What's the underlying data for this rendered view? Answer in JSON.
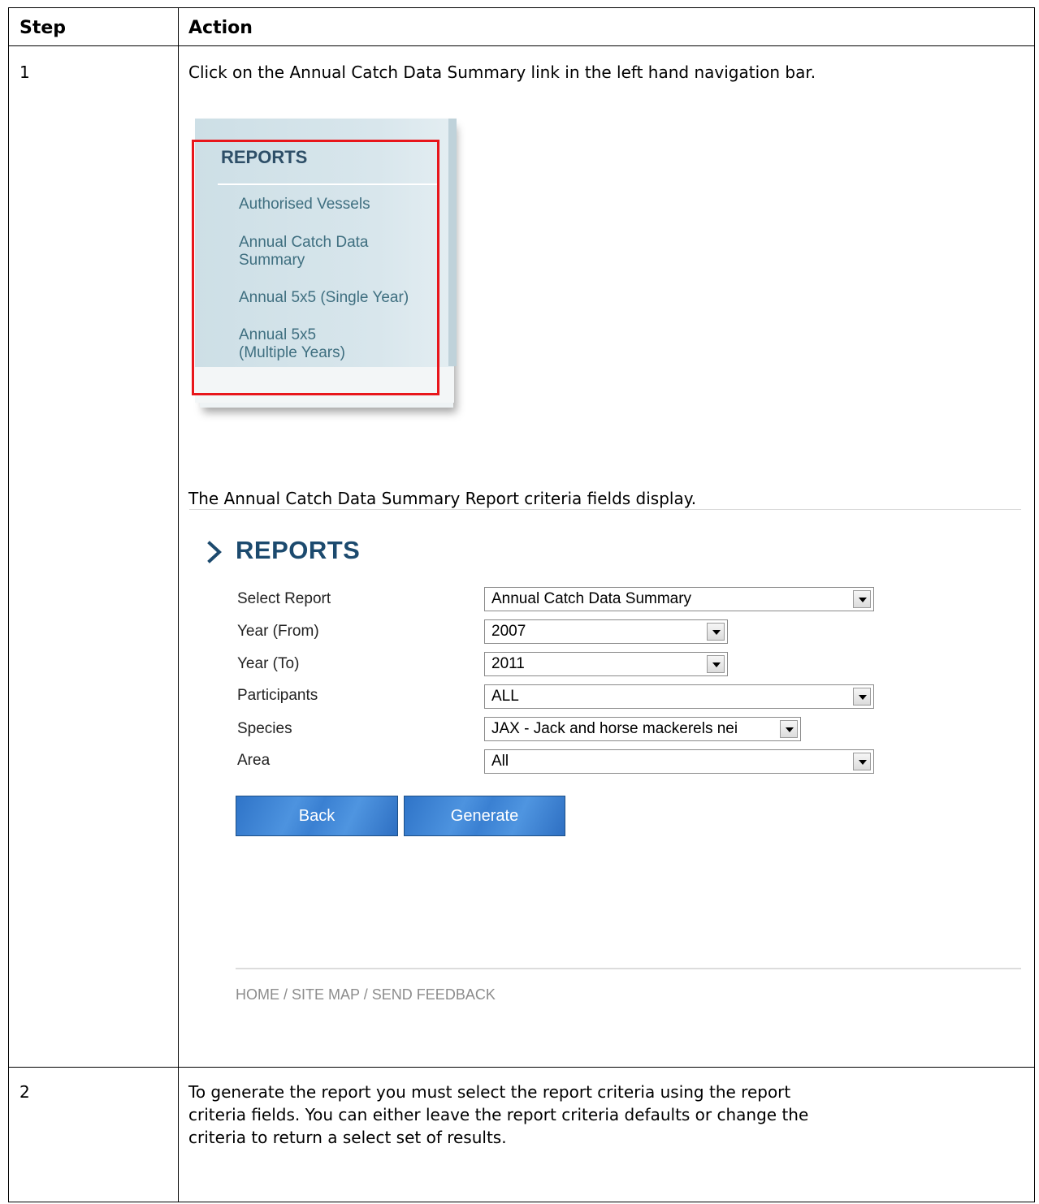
{
  "table": {
    "headers": {
      "step": "Step",
      "action": "Action"
    },
    "rows": [
      {
        "step": "1",
        "intro": "Click on the Annual Catch Data Summary link in the left hand navigation bar.",
        "display_note": "The Annual Catch Data Summary Report criteria fields display."
      },
      {
        "step": "2",
        "text_lines": [
          "To generate the report you must select the report criteria using the report",
          "criteria fields.  You can either leave the report criteria defaults or change the",
          "criteria to return a select set of results."
        ]
      }
    ]
  },
  "nav": {
    "title": "REPORTS",
    "items": [
      {
        "lines": [
          "Authorised Vessels"
        ]
      },
      {
        "lines": [
          "Annual Catch Data",
          "Summary"
        ]
      },
      {
        "lines": [
          "Annual 5x5 (Single Year)"
        ]
      },
      {
        "lines": [
          "Annual 5x5",
          "(Multiple Years)"
        ]
      }
    ],
    "highlight_color": "#e8161b"
  },
  "reports_form": {
    "title": "REPORTS",
    "fields": [
      {
        "label": "Select Report",
        "value": "Annual Catch Data Summary"
      },
      {
        "label": "Year (From)",
        "value": "2007"
      },
      {
        "label": "Year (To)",
        "value": "2011"
      },
      {
        "label": "Participants",
        "value": "ALL"
      },
      {
        "label": "Species",
        "value": "JAX - Jack and horse mackerels nei"
      },
      {
        "label": "Area",
        "value": "All"
      }
    ],
    "buttons": {
      "back": "Back",
      "generate": "Generate"
    },
    "footer": {
      "home": "HOME",
      "site_map": "SITE MAP",
      "feedback": "SEND FEEDBACK",
      "separator": "/"
    },
    "colors": {
      "title": "#1c4a6e",
      "button": "#3a80d2",
      "footer": "#8c8c8c"
    }
  }
}
